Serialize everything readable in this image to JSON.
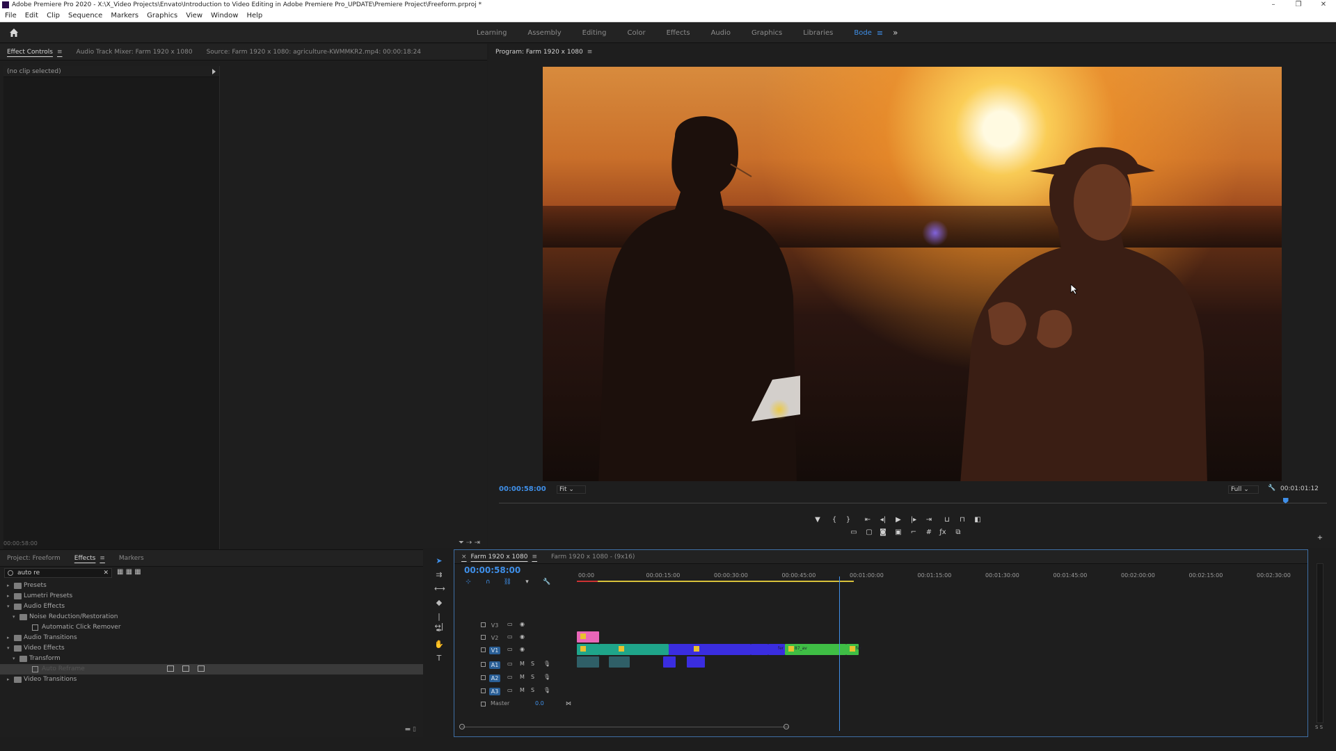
{
  "window": {
    "title": "Adobe Premiere Pro 2020 - X:\\X_Video Projects\\Envato\\Introduction to Video Editing in Adobe Premiere Pro_UPDATE\\Premiere Project\\Freeform.prproj *",
    "controls": [
      "–",
      "❐",
      "✕"
    ]
  },
  "menu": [
    "File",
    "Edit",
    "Clip",
    "Sequence",
    "Markers",
    "Graphics",
    "View",
    "Window",
    "Help"
  ],
  "workspaces": {
    "tabs": [
      "Learning",
      "Assembly",
      "Editing",
      "Color",
      "Effects",
      "Audio",
      "Graphics",
      "Libraries",
      "Bode"
    ],
    "active": "Bode",
    "menu_glyph": "≡",
    "more_glyph": "»"
  },
  "source_panel": {
    "tabs": [
      "Effect Controls",
      "Audio Track Mixer: Farm 1920 x 1080",
      "Source: Farm 1920 x 1080: agriculture-KWMMKR2.mp4: 00:00:18:24"
    ],
    "active_tab": "Effect Controls",
    "menu_glyph": "≡",
    "no_clip": "(no clip selected)",
    "timecode": "00:00:58:00"
  },
  "program_monitor": {
    "title": "Program: Farm 1920 x 1080",
    "menu_glyph": "≡",
    "current_timecode": "00:00:58:00",
    "zoom": "Fit",
    "resolution": "Full",
    "duration": "00:01:01:12",
    "playhead_fraction": 0.95
  },
  "project_panel": {
    "tabs": [
      "Project: Freeform",
      "Effects",
      "Markers"
    ],
    "active_tab": "Effects",
    "menu_glyph": "≡",
    "search_value": "auto re",
    "tree": [
      {
        "label": "Presets",
        "level": 0,
        "expanded": false,
        "type": "folder"
      },
      {
        "label": "Lumetri Presets",
        "level": 0,
        "expanded": false,
        "type": "folder"
      },
      {
        "label": "Audio Effects",
        "level": 0,
        "expanded": true,
        "type": "folder"
      },
      {
        "label": "Noise Reduction/Restoration",
        "level": 1,
        "expanded": true,
        "type": "folder"
      },
      {
        "label": "Automatic Click Remover",
        "level": 2,
        "type": "effect"
      },
      {
        "label": "Audio Transitions",
        "level": 0,
        "expanded": false,
        "type": "folder"
      },
      {
        "label": "Video Effects",
        "level": 0,
        "expanded": true,
        "type": "folder"
      },
      {
        "label": "Transform",
        "level": 1,
        "expanded": true,
        "type": "folder"
      },
      {
        "label": "Auto Reframe",
        "level": 2,
        "type": "effect",
        "selected": true
      },
      {
        "label": "Video Transitions",
        "level": 0,
        "expanded": false,
        "type": "folder"
      }
    ]
  },
  "timeline": {
    "tabs": [
      "Farm 1920 x 1080",
      "Farm 1920 x 1080 - (9x16)"
    ],
    "active_tab": "Farm 1920 x 1080",
    "close_glyph": "×",
    "menu_glyph": "≡",
    "timecode": "00:00:58:00",
    "ruler": [
      "00:00",
      "00:00:15:00",
      "00:00:30:00",
      "00:00:45:00",
      "00:01:00:00",
      "00:01:15:00",
      "00:01:30:00",
      "00:01:45:00",
      "00:02:00:00",
      "00:02:15:00",
      "00:02:30:00"
    ],
    "video_tracks": [
      "V3",
      "V2",
      "V1"
    ],
    "audio_tracks": [
      "A1",
      "A2",
      "A3"
    ],
    "track_mute": "M",
    "track_solo": "S",
    "master_label": "Master",
    "master_value": "0.0",
    "clip_labels": [
      "fer",
      "87_av",
      "fer"
    ],
    "vu_label": "S S"
  },
  "colors": {
    "accent": "#3f8fe8",
    "clip_pink": "#e966b8",
    "clip_teal": "#1fa58a",
    "clip_blue": "#3a2de0",
    "clip_green": "#3fbe45",
    "clip_audio": "#2f5f67"
  }
}
